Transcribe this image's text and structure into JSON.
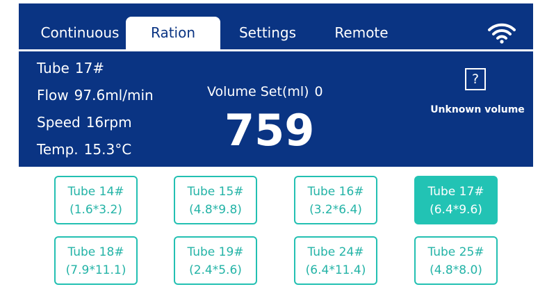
{
  "tabs": [
    {
      "label": "Continuous",
      "active": false
    },
    {
      "label": "Ration",
      "active": true
    },
    {
      "label": "Settings",
      "active": false
    },
    {
      "label": "Remote",
      "active": false
    }
  ],
  "status": {
    "tube": {
      "label": "Tube",
      "value": "17#"
    },
    "flow": {
      "label": "Flow",
      "value": "97.6ml/min"
    },
    "speed": {
      "label": "Speed",
      "value": "16rpm"
    },
    "temp": {
      "label": "Temp.",
      "value": "15.3°C"
    }
  },
  "volume": {
    "set_label": "Volume Set(ml)",
    "set_value": "0",
    "current": "759"
  },
  "unknown_volume": {
    "icon_text": "?",
    "label": "Unknown volume"
  },
  "tubes": [
    {
      "name": "Tube 14#",
      "size": "(1.6*3.2)",
      "selected": false
    },
    {
      "name": "Tube 15#",
      "size": "(4.8*9.8)",
      "selected": false
    },
    {
      "name": "Tube 16#",
      "size": "(3.2*6.4)",
      "selected": false
    },
    {
      "name": "Tube 17#",
      "size": "(6.4*9.6)",
      "selected": true
    },
    {
      "name": "Tube 18#",
      "size": "(7.9*11.1)",
      "selected": false
    },
    {
      "name": "Tube 19#",
      "size": "(2.4*5.6)",
      "selected": false
    },
    {
      "name": "Tube 24#",
      "size": "(6.4*11.4)",
      "selected": false
    },
    {
      "name": "Tube 25#",
      "size": "(4.8*8.0)",
      "selected": false
    }
  ],
  "colors": {
    "primary": "#0a3483",
    "accent": "#22c3b4"
  },
  "icons": {
    "wifi": "wifi-icon",
    "unknown": "question-icon"
  }
}
